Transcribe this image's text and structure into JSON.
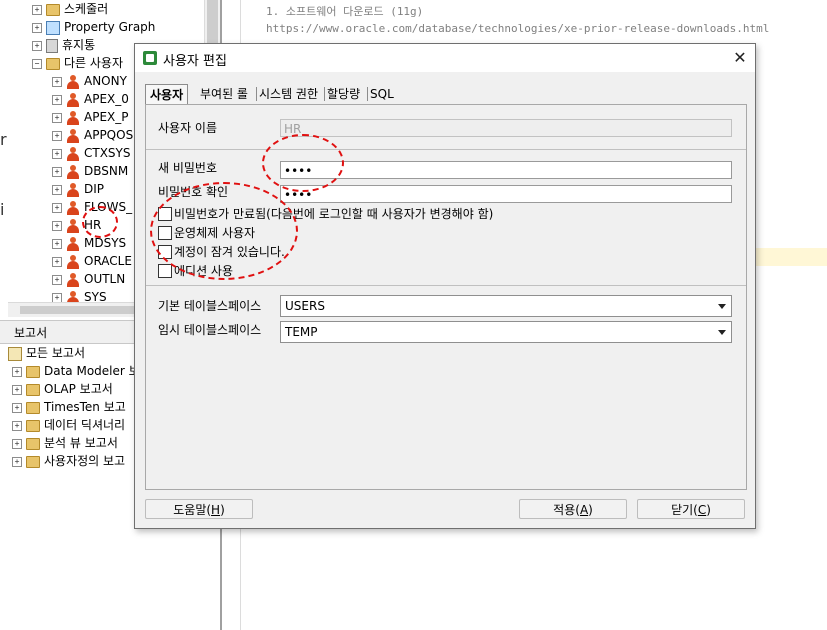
{
  "left_tree": {
    "items": [
      {
        "label": "스케줄러",
        "icon": "folder-icon",
        "depth": 0
      },
      {
        "label": "Property Graph",
        "icon": "graph-icon",
        "depth": 0
      },
      {
        "label": "휴지통",
        "icon": "trash-icon",
        "depth": 0
      },
      {
        "label": "다른 사용자",
        "icon": "folder-icon",
        "depth": 0
      },
      {
        "label": "ANONY",
        "icon": "user-icon",
        "depth": 1
      },
      {
        "label": "APEX_0",
        "icon": "user-icon",
        "depth": 1
      },
      {
        "label": "APEX_P",
        "icon": "user-icon",
        "depth": 1
      },
      {
        "label": "APPQOS",
        "icon": "user-icon",
        "depth": 1
      },
      {
        "label": "CTXSYS",
        "icon": "user-icon",
        "depth": 1
      },
      {
        "label": "DBSNM",
        "icon": "user-icon",
        "depth": 1
      },
      {
        "label": "DIP",
        "icon": "user-icon",
        "depth": 1
      },
      {
        "label": "FLOWS_",
        "icon": "user-icon",
        "depth": 1
      },
      {
        "label": "HR",
        "icon": "user-icon",
        "depth": 1
      },
      {
        "label": "MDSYS",
        "icon": "user-icon",
        "depth": 1
      },
      {
        "label": "ORACLE",
        "icon": "user-icon",
        "depth": 1
      },
      {
        "label": "OUTLN",
        "icon": "user-icon",
        "depth": 1
      },
      {
        "label": "SYS",
        "icon": "user-icon",
        "depth": 1
      }
    ]
  },
  "reports": {
    "header": "보고서",
    "items": [
      {
        "label": "모든 보고서",
        "root": true
      },
      {
        "label": "Data Modeler 보"
      },
      {
        "label": "OLAP 보고서"
      },
      {
        "label": "TimesTen 보고"
      },
      {
        "label": "데이터 딕셔너리"
      },
      {
        "label": "분석 뷰 보고서"
      },
      {
        "label": "사용자정의 보고"
      }
    ]
  },
  "left_cut_text": {
    "r": "r",
    "i": "i"
  },
  "editor": {
    "line1": "1. 소프트웨어 다운로드 (11g)",
    "line2": "https://www.oracle.com/database/technologies/xe-prior-release-downloads.html"
  },
  "dialog": {
    "title": "사용자 편집",
    "close_glyph": "✕",
    "tabs": [
      "사용자",
      "부여된 롤",
      "시스템 권한",
      "할당량",
      "SQL"
    ],
    "fields": {
      "username_label": "사용자 이름",
      "username_value": "HR",
      "new_password_label": "새 비밀번호",
      "new_password_value": "••••",
      "confirm_password_label": "비밀번호 확인",
      "confirm_password_value": "••••"
    },
    "checkboxes": [
      {
        "label": "비밀번호가 만료됨(다음번에 로그인할 때 사용자가 변경해야 함)",
        "checked": false
      },
      {
        "label": "운영체제 사용자",
        "checked": false
      },
      {
        "label": "계정이 잠겨 있습니다.",
        "checked": false
      },
      {
        "label": "에디션 사용",
        "checked": false
      }
    ],
    "tablespaces": {
      "default_label": "기본 테이블스페이스",
      "default_value": "USERS",
      "temp_label": "임시 테이블스페이스",
      "temp_value": "TEMP"
    },
    "buttons": {
      "help": "도움말",
      "help_key": "H",
      "apply": "적용",
      "apply_key": "A",
      "close": "닫기",
      "close_key": "C"
    }
  },
  "colors": {
    "annotation": "#e01010",
    "accent": "#2d8a3a"
  }
}
